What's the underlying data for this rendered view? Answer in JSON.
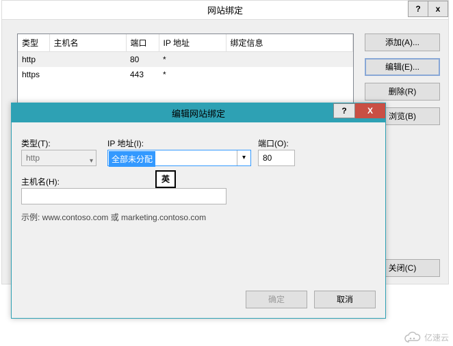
{
  "mainDialog": {
    "title": "网站绑定",
    "helpGlyph": "?",
    "closeGlyph": "x",
    "columns": {
      "type": "类型",
      "host": "主机名",
      "port": "端口",
      "ip": "IP 地址",
      "info": "绑定信息"
    },
    "rows": [
      {
        "type": "http",
        "host": "",
        "port": "80",
        "ip": "*",
        "info": ""
      },
      {
        "type": "https",
        "host": "",
        "port": "443",
        "ip": "*",
        "info": ""
      }
    ],
    "buttons": {
      "add": "添加(A)...",
      "edit": "编辑(E)...",
      "remove": "删除(R)",
      "browse": "浏览(B)",
      "close": "关闭(C)"
    }
  },
  "editDialog": {
    "title": "编辑网站绑定",
    "helpGlyph": "?",
    "closeGlyph": "X",
    "labels": {
      "type": "类型(T):",
      "ip": "IP 地址(I):",
      "port": "端口(O):",
      "host": "主机名(H):"
    },
    "fields": {
      "type": "http",
      "ip": "全部未分配",
      "port": "80",
      "host": ""
    },
    "ime": "英",
    "example": "示例: www.contoso.com 或 marketing.contoso.com",
    "buttons": {
      "ok": "确定",
      "cancel": "取消"
    }
  },
  "watermark": "亿速云"
}
